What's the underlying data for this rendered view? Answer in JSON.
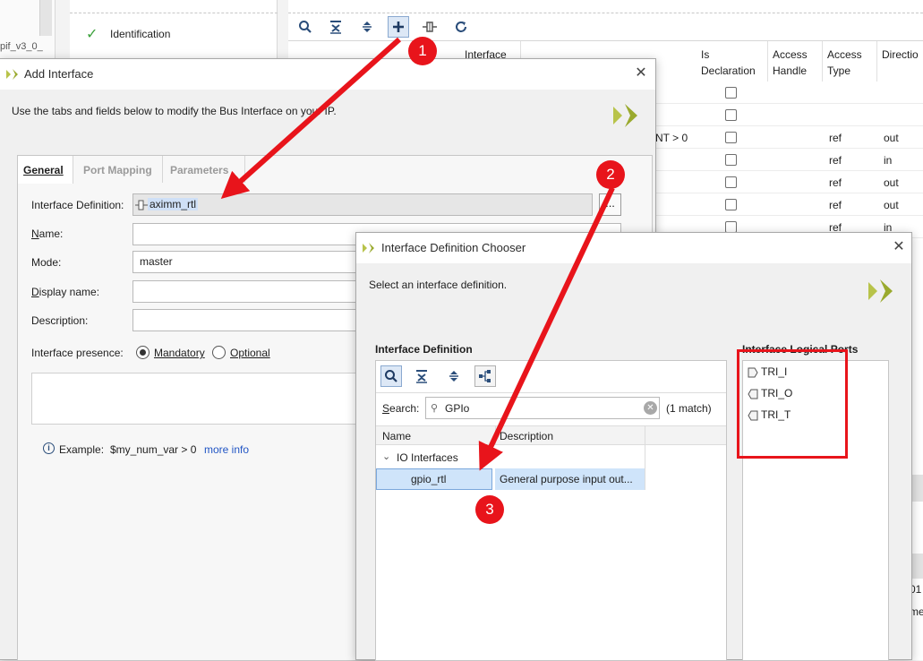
{
  "background": {
    "truncated_label": "pif_v3_0_",
    "nav_item": "Identification",
    "columns": {
      "interface": "Interface",
      "is_declaration": "Is Declaration",
      "access_handle": "Access Handle",
      "access_type": "Access Type",
      "direction": "Directio"
    },
    "rows": [
      {
        "frag": "",
        "access_type": "",
        "direction": ""
      },
      {
        "frag": "",
        "access_type": "",
        "direction": ""
      },
      {
        "frag": "NT > 0",
        "access_type": "ref",
        "direction": "out"
      },
      {
        "frag": "",
        "access_type": "ref",
        "direction": "in"
      },
      {
        "frag": "",
        "access_type": "ref",
        "direction": "out"
      },
      {
        "frag": "",
        "access_type": "ref",
        "direction": "out"
      },
      {
        "frag": "",
        "access_type": "ref",
        "direction": "in"
      }
    ],
    "edge_fragments": [
      "01",
      "me"
    ]
  },
  "add_interface": {
    "title": "Add Interface",
    "instructions": "Use the tabs and fields below to modify the Bus Interface on your IP.",
    "tabs": [
      "General",
      "Port Mapping",
      "Parameters"
    ],
    "fields": {
      "interface_definition_label": "Interface Definition:",
      "interface_definition_value": "aximm_rtl",
      "browse_label": "...",
      "name_label": "Name:",
      "name_value": "",
      "mode_label": "Mode:",
      "mode_value": "master",
      "display_name_label": "Display name:",
      "display_name_value": "",
      "description_label": "Description:",
      "description_value": ""
    },
    "presence": {
      "label": "Interface presence:",
      "mandatory": "Mandatory",
      "optional": "Optional",
      "selected": "Mandatory"
    },
    "example_prefix": "Example:",
    "example_code": "$my_num_var > 0",
    "more_info": "more info"
  },
  "chooser": {
    "title": "Interface Definition Chooser",
    "instructions": "Select an interface definition.",
    "definition_heading": "Interface Definition",
    "ports_heading": "Interface Logical Ports",
    "search_label": "Search:",
    "search_value": "GPIo",
    "match_count": "(1 match)",
    "table_headers": [
      "Name",
      "Description"
    ],
    "group": "IO Interfaces",
    "selected_row": {
      "name": "gpio_rtl",
      "description": "General purpose input out..."
    },
    "ports": [
      "TRI_I",
      "TRI_O",
      "TRI_T"
    ]
  },
  "annotations": {
    "steps": [
      "1",
      "2",
      "3"
    ],
    "arrow_color": "#e8141b",
    "highlight_color": "#e8141b"
  },
  "colors": {
    "vivado_logo": "#b8c34a",
    "selection": "#cfe4fa",
    "accent_green": "#3ca13c"
  }
}
